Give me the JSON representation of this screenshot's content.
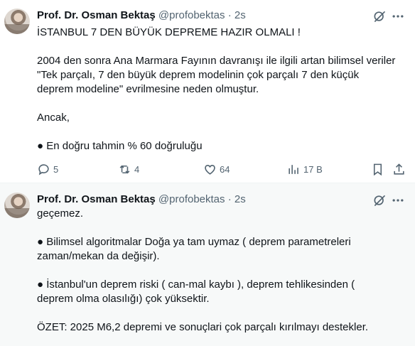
{
  "tweets": [
    {
      "author_name": "Prof. Dr. Osman Bektaş",
      "handle": "@profobektas",
      "separator": "·",
      "time": "2s",
      "lines": [
        "İSTANBUL 7 DEN BÜYÜK DEPREME HAZIR OLMALI !",
        "",
        "2004 den sonra Ana Marmara Fayının davranışı ile ilgili artan bilimsel veriler",
        "\"Tek parçalı, 7 den büyük deprem modelinin çok parçalı 7 den küçük",
        "deprem modeline\" evrilmesine neden olmuştur.",
        "",
        "Ancak,",
        "",
        "● En doğru tahmin % 60 doğruluğu"
      ],
      "actions": {
        "reply_count": "5",
        "retweet_count": "4",
        "like_count": "64",
        "views_count": "17 B"
      }
    },
    {
      "author_name": "Prof. Dr. Osman Bektaş",
      "handle": "@profobektas",
      "separator": "·",
      "time": "2s",
      "lines": [
        "geçemez.",
        "",
        "● Bilimsel algoritmalar Doğa ya tam uymaz ( deprem parametreleri",
        "zaman/mekan da değişir).",
        "",
        "● İstanbul'un deprem riski ( can-mal kaybı ), deprem tehlikesinden (",
        "deprem olma olasılığı) çok yüksektir.",
        "",
        "ÖZET: 2025 M6,2 depremi ve sonuçlari çok parçalı kırılmayı destekler."
      ]
    }
  ],
  "icons": [
    "grok-icon",
    "more-icon",
    "reply-icon",
    "retweet-icon",
    "like-icon",
    "views-icon",
    "bookmark-icon",
    "share-icon"
  ],
  "colors": {
    "text": "#0f1419",
    "muted": "#536471",
    "hover_bg": "#f7f9f9"
  }
}
